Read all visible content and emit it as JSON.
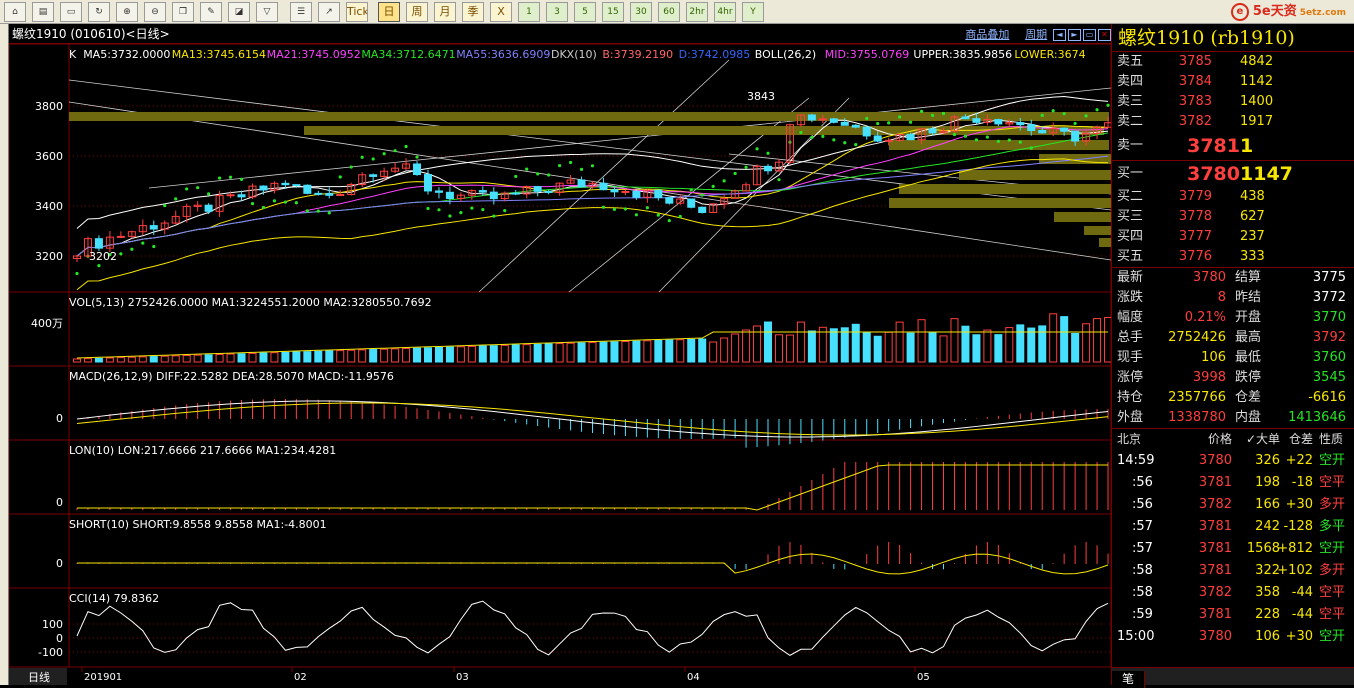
{
  "toolbar": {
    "icons": [
      "home-icon",
      "chart-icon",
      "monitor-icon",
      "refresh-icon",
      "zoom-in-icon",
      "zoom-out-icon",
      "window-icon",
      "pen-icon",
      "eraser-icon",
      "filter-icon",
      "list-icon",
      "trend-icon"
    ],
    "tick": "Tick",
    "periods": [
      "日",
      "周",
      "月",
      "季",
      "X"
    ],
    "minutes": [
      "1",
      "3",
      "5",
      "15",
      "30",
      "60",
      "2hr",
      "4hr",
      "Y"
    ],
    "brand": "5e天资",
    "brand_domain": "5etz.com"
  },
  "chart": {
    "header": "螺纹1910 (010610)<日线>",
    "header_links": [
      "商品叠加",
      "周期"
    ],
    "main_legend": [
      {
        "text": "K",
        "color": "#ffffff"
      },
      {
        "text": "MA5:3732.0000",
        "color": "#ffffff"
      },
      {
        "text": "MA13:3745.6154",
        "color": "#f7e600"
      },
      {
        "text": "MA21:3745.0952",
        "color": "#ff40ff"
      },
      {
        "text": "MA34:3712.6471",
        "color": "#25e525"
      },
      {
        "text": "MA55:3636.6909",
        "color": "#8080ff"
      },
      {
        "text": "DKX(10)",
        "color": "#cccccc"
      },
      {
        "text": "B:3739.2190",
        "color": "#ff6666"
      },
      {
        "text": "D:3742.0985",
        "color": "#3366ff"
      },
      {
        "text": "BOLL(26,2)",
        "color": "#ffffff"
      },
      {
        "text": "MID:3755.0769",
        "color": "#ff40ff"
      },
      {
        "text": "UPPER:3835.9856",
        "color": "#ffffff"
      },
      {
        "text": "LOWER:3674",
        "color": "#f7e600"
      }
    ],
    "y_labels": [
      "3800",
      "3600",
      "3400",
      "3200"
    ],
    "hi_label": "3843",
    "lo_label": "3202",
    "vol_legend": "VOL(5,13) 2752426.0000  MA1:3224551.2000  MA2:3280550.7692",
    "vol_tick": "400万",
    "macd_legend": "MACD(26,12,9) DIFF:22.5282  DEA:28.5070  MACD:-11.9576",
    "macd_tick": "0",
    "lon_legend": "LON(10) LON:217.6666  217.6666  MA1:234.4281",
    "lon_tick": "0",
    "short_legend": "SHORT(10) SHORT:9.8558  9.8558  MA1:-4.8001",
    "short_tick": "0",
    "cci_legend": "CCI(14) 79.8362",
    "cci_ticks": [
      "100",
      "0",
      "-100"
    ],
    "x_labels": [
      "201901",
      "02",
      "03",
      "04",
      "05"
    ],
    "period_tab": "日线"
  },
  "quote": {
    "title": "螺纹1910 (rb1910)",
    "asks": [
      {
        "label": "卖五",
        "price": "3785",
        "vol": "4842"
      },
      {
        "label": "卖四",
        "price": "3784",
        "vol": "1142"
      },
      {
        "label": "卖三",
        "price": "3783",
        "vol": "1400"
      },
      {
        "label": "卖二",
        "price": "3782",
        "vol": "1917"
      },
      {
        "label": "卖一",
        "price": "3781",
        "vol": "1"
      }
    ],
    "bids": [
      {
        "label": "买一",
        "price": "3780",
        "vol": "1147"
      },
      {
        "label": "买二",
        "price": "3779",
        "vol": "438"
      },
      {
        "label": "买三",
        "price": "3778",
        "vol": "627"
      },
      {
        "label": "买四",
        "price": "3777",
        "vol": "237"
      },
      {
        "label": "买五",
        "price": "3776",
        "vol": "333"
      }
    ],
    "stats": [
      {
        "l1": "最新",
        "v1": "3780",
        "c1": "red",
        "l2": "结算",
        "v2": "3775",
        "c2": "white"
      },
      {
        "l1": "涨跌",
        "v1": "8",
        "c1": "red",
        "l2": "昨结",
        "v2": "3772",
        "c2": "white"
      },
      {
        "l1": "幅度",
        "v1": "0.21%",
        "c1": "red",
        "l2": "开盘",
        "v2": "3770",
        "c2": "green"
      },
      {
        "l1": "总手",
        "v1": "2752426",
        "c1": "yellow",
        "l2": "最高",
        "v2": "3792",
        "c2": "red"
      },
      {
        "l1": "现手",
        "v1": "106",
        "c1": "yellow",
        "l2": "最低",
        "v2": "3760",
        "c2": "green"
      },
      {
        "l1": "涨停",
        "v1": "3998",
        "c1": "red",
        "l2": "跌停",
        "v2": "3545",
        "c2": "green"
      },
      {
        "l1": "持仓",
        "v1": "2357766",
        "c1": "yellow",
        "l2": "仓差",
        "v2": "-6616",
        "c2": "yellow"
      },
      {
        "l1": "外盘",
        "v1": "1338780",
        "c1": "red",
        "l2": "内盘",
        "v2": "1413646",
        "c2": "green"
      }
    ],
    "tick_header": [
      "北京",
      "价格",
      "✓大单",
      "仓差",
      "性质"
    ],
    "ticks": [
      {
        "time": "14:59",
        "price": "3780",
        "vol": "326",
        "oi": "+22",
        "type": "空开",
        "tc": "green"
      },
      {
        "time": ":56",
        "price": "3781",
        "vol": "198",
        "oi": "-18",
        "type": "空平",
        "tc": "red"
      },
      {
        "time": ":56",
        "price": "3782",
        "vol": "166",
        "oi": "+30",
        "type": "多开",
        "tc": "red"
      },
      {
        "time": ":57",
        "price": "3781",
        "vol": "242",
        "oi": "-128",
        "type": "多平",
        "tc": "green"
      },
      {
        "time": ":57",
        "price": "3781",
        "vol": "1568",
        "oi": "+812",
        "type": "空开",
        "tc": "green"
      },
      {
        "time": ":58",
        "price": "3781",
        "vol": "322",
        "oi": "+102",
        "type": "多开",
        "tc": "red"
      },
      {
        "time": ":58",
        "price": "3782",
        "vol": "358",
        "oi": "-44",
        "type": "空平",
        "tc": "red"
      },
      {
        "time": ":59",
        "price": "3781",
        "vol": "228",
        "oi": "-44",
        "type": "空平",
        "tc": "red"
      },
      {
        "time": "15:00",
        "price": "3780",
        "vol": "106",
        "oi": "+30",
        "type": "空开",
        "tc": "green"
      }
    ],
    "bottom_tab": "笔"
  }
}
